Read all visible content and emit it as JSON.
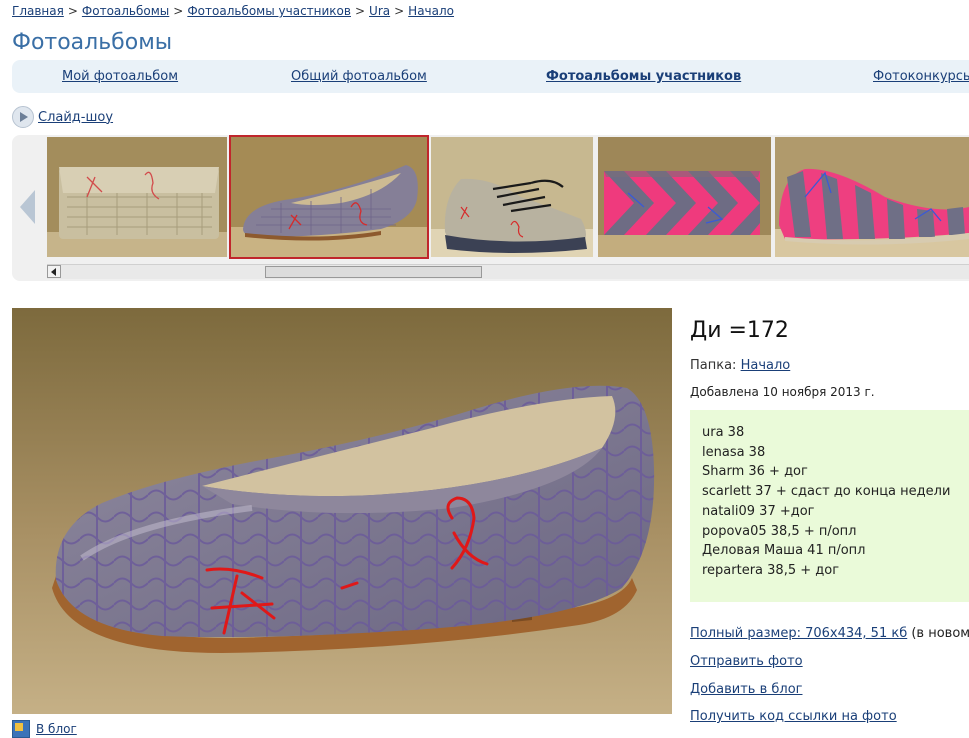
{
  "breadcrumb": {
    "items": [
      "Главная",
      "Фотоальбомы",
      "Фотоальбомы участников",
      "Ura",
      "Начало"
    ],
    "separator": ">"
  },
  "page_title": "Фотоальбомы",
  "tabs": [
    {
      "label": "Мой фотоальбом",
      "active": false
    },
    {
      "label": "Общий фотоальбом",
      "active": false
    },
    {
      "label": "Фотоальбомы участников",
      "active": true
    },
    {
      "label": "Фотоконкурсы",
      "active": false
    }
  ],
  "slideshow_label": "Слайд-шоу",
  "thumbnails": [
    {
      "icon": "clutch-croc-thumbnail",
      "selected": false
    },
    {
      "icon": "purple-flat-thumbnail",
      "selected": true
    },
    {
      "icon": "sneaker-thumbnail",
      "selected": false
    },
    {
      "icon": "pink-clutch-thumbnail",
      "selected": false
    },
    {
      "icon": "pink-flat-thumbnail",
      "selected": false
    }
  ],
  "photo": {
    "title": "Ди =172",
    "folder_label": "Папка:",
    "folder_link": "Начало",
    "added": "Добавлена 10 ноября 2013 г.",
    "description": [
      "ura 38",
      "lenasa 38",
      "Sharm 36 + дог",
      "scarlett 37 + сдаст до конца недели",
      "natali09 37 +дог",
      "popova05 38,5 + п/опл",
      "Деловая Маша 41 п/опл",
      "repartera 38,5 + дог"
    ]
  },
  "actions": {
    "full_size_link": "Полный размер: 706x434, 51 кб",
    "full_size_suffix": "(в новом о",
    "send_photo": "Отправить фото",
    "add_to_blog": "Добавить в блог",
    "get_link_code": "Получить код ссылки на фото"
  },
  "blog_bottom_label": "В блог",
  "colors": {
    "title_blue": "#3a6fa6",
    "link_blue": "#1a3f78",
    "tab_bg": "#eaf2f8",
    "desc_bg": "#eafad9",
    "selected_border": "#c0262c"
  }
}
